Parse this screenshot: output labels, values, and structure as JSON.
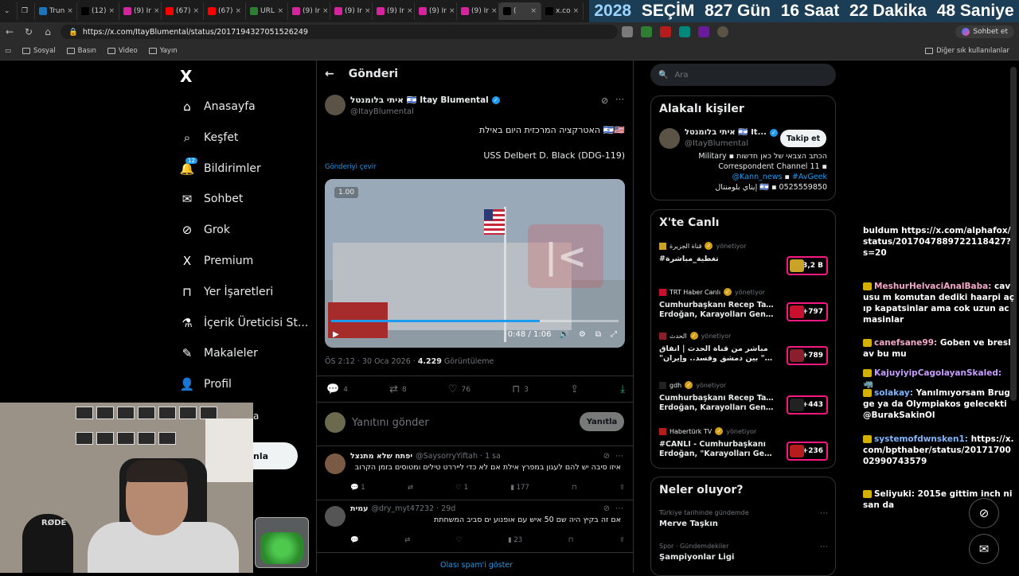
{
  "browser": {
    "tabs": [
      {
        "label": "Trun",
        "icon": "trt-icon",
        "color": "#1b75bb"
      },
      {
        "label": "(12)",
        "icon": "x-icon",
        "color": "#000000"
      },
      {
        "label": "(9) Ir",
        "icon": "instagram-icon",
        "color": "#d6249f"
      },
      {
        "label": "(67)",
        "icon": "youtube-icon",
        "color": "#ff0000"
      },
      {
        "label": "(67)",
        "icon": "youtube-icon",
        "color": "#ff0000"
      },
      {
        "label": "URL",
        "icon": "url-icon",
        "color": "#2e7d32"
      },
      {
        "label": "(9) Ir",
        "icon": "instagram-icon",
        "color": "#d6249f"
      },
      {
        "label": "(9) Ir",
        "icon": "instagram-icon",
        "color": "#d6249f"
      },
      {
        "label": "(9) Ir",
        "icon": "instagram-icon",
        "color": "#d6249f"
      },
      {
        "label": "(9) Ir",
        "icon": "instagram-icon",
        "color": "#d6249f"
      },
      {
        "label": "(9) Ir",
        "icon": "instagram-icon",
        "color": "#d6249f"
      },
      {
        "label": "(",
        "icon": "x-icon",
        "color": "#000000",
        "active": true
      },
      {
        "label": "x.co",
        "icon": "x-icon",
        "color": "#000000"
      }
    ],
    "url": "https://x.com/ItayBlumental/status/2017194327051526249",
    "copilot_label": "Sohbet et",
    "bookmarks": [
      "Sosyal",
      "Basın",
      "Video",
      "Yayın"
    ],
    "other_bookmarks": "Diğer sık kullanılanlar"
  },
  "countdown": {
    "year": "2028",
    "label": "SEÇİM",
    "days": "827 Gün",
    "hours": "16 Saat",
    "minutes": "22 Dakika",
    "seconds": "48 Saniye"
  },
  "sidebar": {
    "logo": "X",
    "items": [
      {
        "label": "Anasayfa",
        "icon": "home-icon"
      },
      {
        "label": "Keşfet",
        "icon": "search-icon"
      },
      {
        "label": "Bildirimler",
        "icon": "bell-icon",
        "badge": "12"
      },
      {
        "label": "Sohbet",
        "icon": "mail-icon"
      },
      {
        "label": "Grok",
        "icon": "grok-icon"
      },
      {
        "label": "Premium",
        "icon": "x-premium-icon"
      },
      {
        "label": "Yer İşaretleri",
        "icon": "bookmark-icon"
      },
      {
        "label": "İçerik Üreticisi St...",
        "icon": "flask-icon"
      },
      {
        "label": "Makaleler",
        "icon": "article-icon"
      },
      {
        "label": "Profil",
        "icon": "person-icon"
      }
    ],
    "post_button_partial": "nla",
    "more_partial": "a"
  },
  "post": {
    "header_title": "Gönderi",
    "author_name": "איתי בלומנטל 🇮🇱 Itay Blumental",
    "author_handle": "@ItayBlumental",
    "text_line1": "האטרקציה המרכזית היום באילת 🇮🇱🇺🇸",
    "text_line2": "USS Delbert D. Black (DDG-119)",
    "translate": "Gönderiyi çevir",
    "video": {
      "speed": "1.00",
      "time": "0:48 / 1:06",
      "progress": 0.727
    },
    "meta_time": "ÖS 2:12 · 30 Oca 2026 · ",
    "meta_views": "4.229",
    "meta_views_label": " Görüntüleme",
    "actions": {
      "replies": "4",
      "reposts": "8",
      "likes": "76",
      "bookmarks": "3"
    },
    "reply_placeholder": "Yanıtını gönder",
    "reply_button": "Yanıtla"
  },
  "replies": [
    {
      "name": "יפתח שלא מתנצל",
      "handle": "@SaysorryYiftah · 1 sa",
      "text": "איזו סיבה יש להם לעגון במפרץ אילת אם לא כדי לייררט טילים ומטוסים בזמן הקרוב",
      "replies": "1",
      "reposts": "",
      "likes": "1",
      "views": "177"
    },
    {
      "name": "עמית",
      "handle": "@dry_myt47232 · 29d",
      "text": "אם זה בקיץ היה שם 50 איש עם אופנוע ים סביב המשחתת",
      "replies": "",
      "reposts": "",
      "likes": "",
      "views": "23"
    }
  ],
  "spam_link": "Olası spam'i göster",
  "right": {
    "search_placeholder": "Ara",
    "related_title": "Alakalı kişiler",
    "related": {
      "name": "איתי בלומנטל 🇮🇱 It...",
      "handle": "@ItayBlumental",
      "follow": "Takip et",
      "bio1": "Military ▪ הכתב הצבאי של כאן חדשות",
      "bio2": "Correspondent Channel 11 ▪",
      "bio3a": "@Kann_news",
      "bio3b": "#AvGeek",
      "bio4": "إيتاي بلومنتال 🇮🇱 ▪ 0525559850"
    },
    "live_title": "X'te Canlı",
    "live": [
      {
        "source": "قناة الجزيرة",
        "status": "yönetiyor",
        "title": "#تغطية_مباشرة",
        "title2": "",
        "count": "+3,2 B",
        "thumb": "#c9a227"
      },
      {
        "source": "TRT Haber Canlı",
        "status": "yönetiyor",
        "title": "Cumhurbaşkanı Recep Tayyip",
        "title2": "Erdoğan, Karayolları Genel ...",
        "count": "+797",
        "thumb": "#c8102e"
      },
      {
        "source": "الحدث",
        "status": "yönetiyor",
        "title": "مباشر من قناة الحدث | اتفاق",
        "title2": "\"تاريخي\" بين دمشق وقسد.. وإيران",
        "count": "+789",
        "thumb": "#8b1e2d"
      },
      {
        "source": "gdh",
        "status": "yönetiyor",
        "title": "Cumhurbaşkanı Recep Tayyip",
        "title2": "Erdoğan, Karayolları Genel ...",
        "count": "+443",
        "thumb": "#222222"
      },
      {
        "source": "Habertürk TV",
        "status": "yönetiyor",
        "title": "#CANLI - Cumhurbaşkanı",
        "title2": "Erdoğan, \"Karayolları Genel ...",
        "count": "+236",
        "thumb": "#b71c1c"
      }
    ],
    "trends_title": "Neler oluyor?",
    "trends": [
      {
        "context": "Türkiye tarihinde gündemde",
        "name": "Merve Taşkın"
      },
      {
        "context": "Spor · Gündemdekiler",
        "name": "Şampiyonlar Ligi"
      }
    ]
  },
  "chat": [
    {
      "name": "",
      "text": "buldum https://x.com/alphafox/status/2017047889722118427?s=20",
      "color": "#ffffff"
    },
    {
      "name": "MeshurHelvaciAnalBaba:",
      "text": " cavusu m komutan dediki haarpi açıp kapatsinlar ama cok uzun acmasinlar",
      "color": "#f4a7c8"
    },
    {
      "name": "canefsane99:",
      "text": " Goben ve breslav bu mu",
      "color": "#f4a7c8"
    },
    {
      "name": "KajuyiyipCagolayanSkaled:",
      "text": " 🦏",
      "color": "#c79dff"
    },
    {
      "name": "solakay:",
      "text": " Yanılmıyorsam Brugge ya da Olympiakos gelecekti @BurakSakinOl",
      "color": "#7fb6ff"
    },
    {
      "name": "systemofdwnsken1:",
      "text": " https://x.com/bpthaber/status/2017170002990743579",
      "color": "#7fb6ff"
    },
    {
      "name": "Seliyuki:",
      "text": " 2015e gittim inch ni san da",
      "color": "#ffffff"
    }
  ],
  "webcam": {
    "mic_brand": "RØDE"
  }
}
